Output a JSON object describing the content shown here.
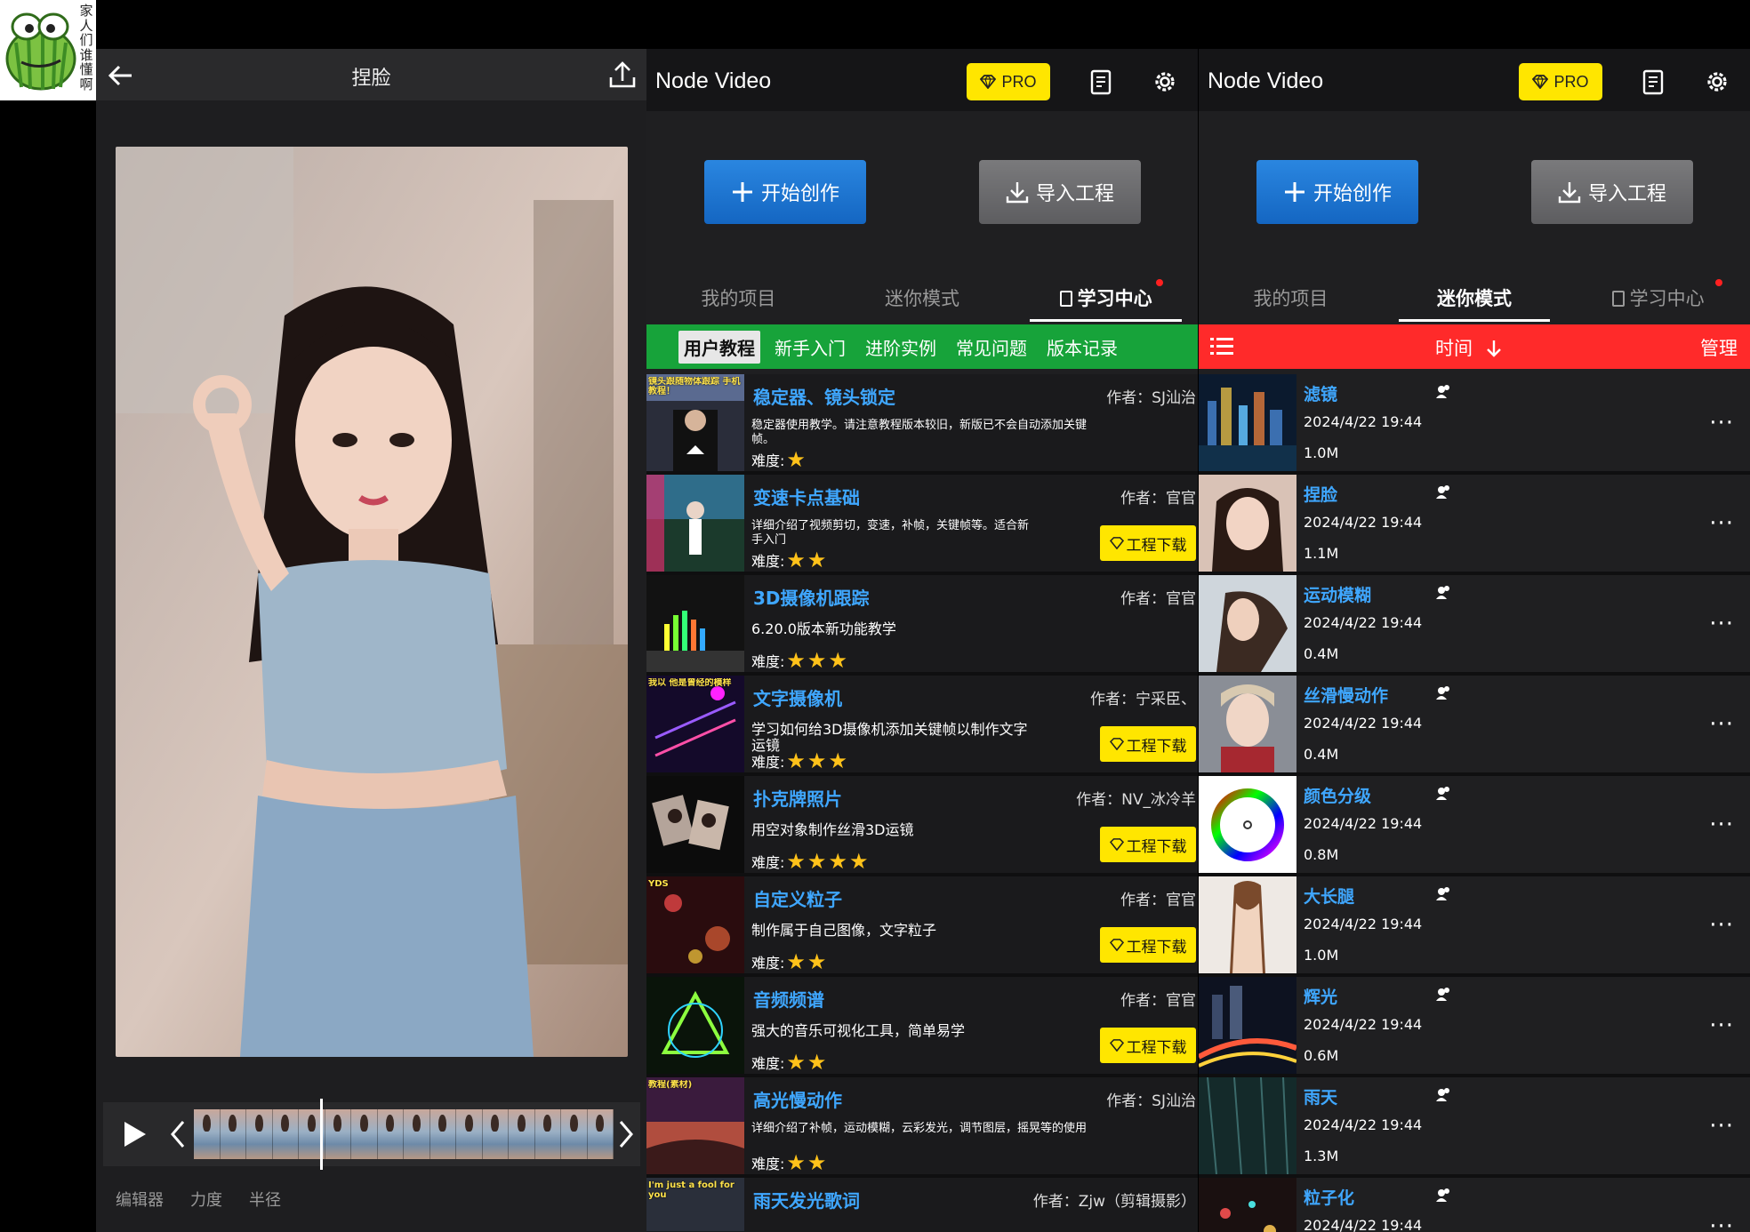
{
  "logo": {
    "caption": "家人们谁懂啊"
  },
  "editor": {
    "title": "捏脸",
    "tools": [
      "编辑器",
      "力度",
      "半径"
    ]
  },
  "app": {
    "name": "Node Video",
    "pro_label": "PRO",
    "create_label": "开始创作",
    "import_label": "导入工程",
    "tabs": [
      "我的项目",
      "迷你模式",
      "学习中心"
    ]
  },
  "learning": {
    "subtabs": [
      "用户教程",
      "新手入门",
      "进阶实例",
      "常见问题",
      "版本记录"
    ],
    "difficulty_label": "难度:",
    "download_label": "工程下载",
    "items": [
      {
        "title": "稳定器、镜头锁定",
        "author": "作者：SJ汕治",
        "desc": "稳定器使用教学。请注意教程版本较旧，新版已不会自动添加关键帧。",
        "stars": 1,
        "download": false,
        "small": true,
        "thumb_text": "镜头跟随物体跟踪 手机教程！"
      },
      {
        "title": "变速卡点基础",
        "author": "作者：官官",
        "desc": "详细介绍了视频剪切，变速，补帧，关键帧等。适合新手入门",
        "stars": 2,
        "download": true,
        "small": true
      },
      {
        "title": "3D摄像机跟踪",
        "author": "作者：官官",
        "desc": "6.20.0版本新功能教学",
        "stars": 3,
        "download": false,
        "small": false
      },
      {
        "title": "文字摄像机",
        "author": "作者：宁采臣、",
        "desc": "学习如何给3D摄像机添加关键帧以制作文字运镜",
        "stars": 3,
        "download": true,
        "small": false,
        "thumb_text": "我以 他是曾经的模样"
      },
      {
        "title": "扑克牌照片",
        "author": "作者：NV_冰冷羊",
        "desc": "用空对象制作丝滑3D运镜",
        "stars": 4,
        "download": true,
        "small": false
      },
      {
        "title": "自定义粒子",
        "author": "作者：官官",
        "desc": "制作属于自己图像，文字粒子",
        "stars": 2,
        "download": true,
        "small": false,
        "thumb_text": "YDS"
      },
      {
        "title": "音频频谱",
        "author": "作者：官官",
        "desc": "强大的音乐可视化工具，简单易学",
        "stars": 2,
        "download": true,
        "small": false
      },
      {
        "title": "高光慢动作",
        "author": "作者：SJ汕治",
        "desc": "详细介绍了补帧，运动模糊，云彩发光，调节图层，摇晃等的使用",
        "stars": 2,
        "download": false,
        "small": true,
        "thumb_text": "教程(素材)"
      },
      {
        "title": "雨天发光歌词",
        "author": "作者：Zjw（剪辑摄影）",
        "desc": "",
        "stars": 0,
        "download": false,
        "small": true,
        "thumb_text": "I'm just a fool for you"
      }
    ]
  },
  "mini": {
    "sort_label": "时间",
    "manage_label": "管理",
    "more": "···",
    "items": [
      {
        "name": "滤镜",
        "date": "2024/4/22 19:44",
        "size": "1.0M"
      },
      {
        "name": "捏脸",
        "date": "2024/4/22 19:44",
        "size": "1.1M"
      },
      {
        "name": "运动模糊",
        "date": "2024/4/22 19:44",
        "size": "0.4M"
      },
      {
        "name": "丝滑慢动作",
        "date": "2024/4/22 19:44",
        "size": "0.4M"
      },
      {
        "name": "颜色分级",
        "date": "2024/4/22 19:44",
        "size": "0.8M"
      },
      {
        "name": "大长腿",
        "date": "2024/4/22 19:44",
        "size": "1.0M"
      },
      {
        "name": "辉光",
        "date": "2024/4/22 19:44",
        "size": "0.6M"
      },
      {
        "name": "雨天",
        "date": "2024/4/22 19:44",
        "size": "1.3M"
      },
      {
        "name": "粒子化",
        "date": "2024/4/22 19:44",
        "size": ""
      }
    ]
  },
  "colors": {
    "accent_blue": "#3fa7ff",
    "pro_yellow": "#ffe600",
    "subtab_green": "#17a33a",
    "bar_red": "#ff2a2a"
  }
}
